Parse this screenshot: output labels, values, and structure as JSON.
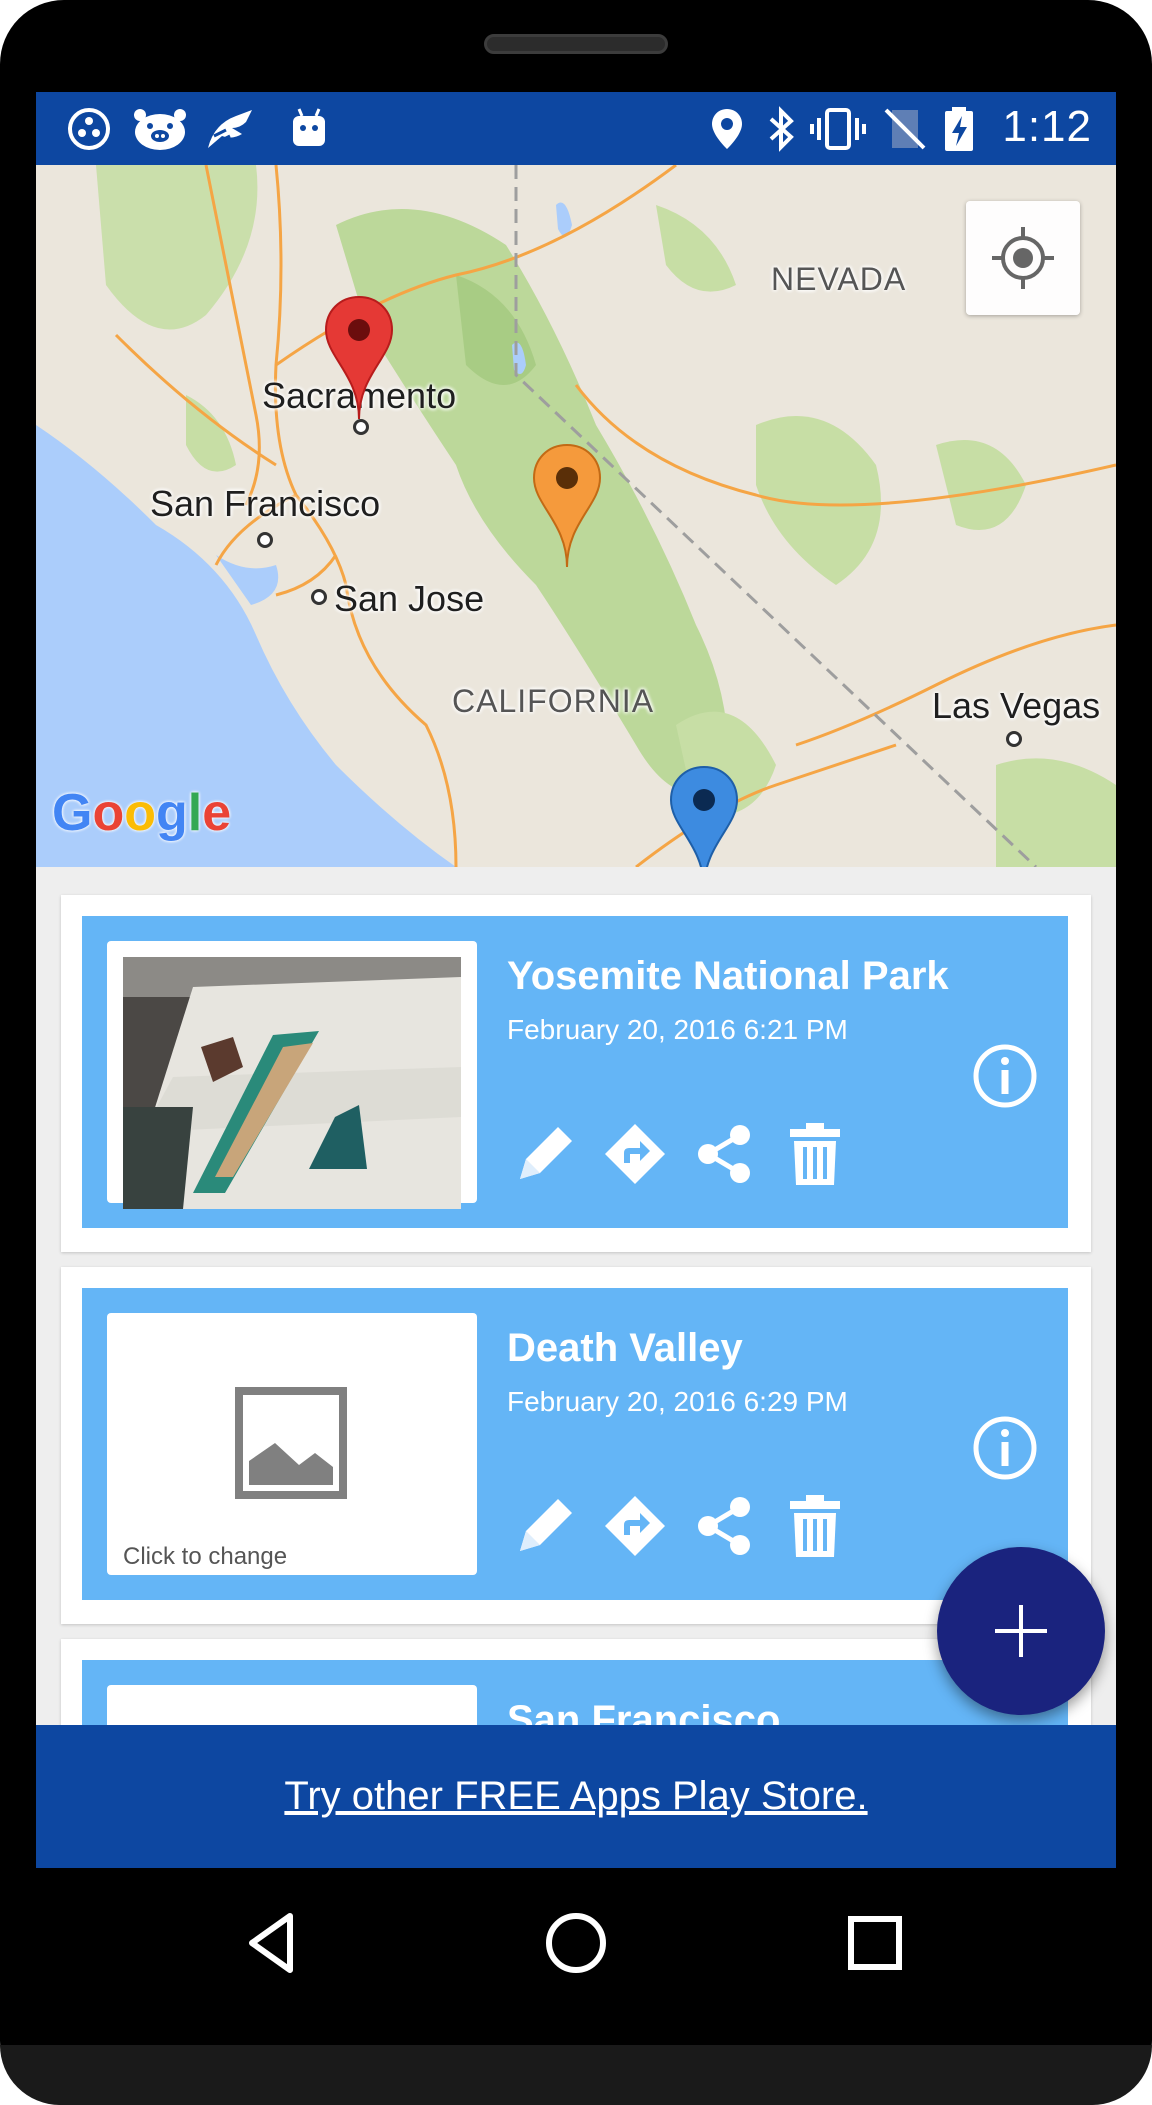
{
  "status_bar": {
    "time": "1:12",
    "left_icons": [
      "dots-circle-icon",
      "pig-icon",
      "bird-icon",
      "android-icon"
    ],
    "right_icons": [
      "location-icon",
      "bluetooth-icon",
      "vibrate-icon",
      "no-signal-icon",
      "battery-charging-icon"
    ],
    "background": "#0d47a1"
  },
  "map": {
    "labels": {
      "nevada": "NEVADA",
      "sacramento": "Sacramento",
      "san_francisco": "San Francisco",
      "san_jose": "San Jose",
      "california": "CALIFORNIA",
      "las_vegas": "Las Vegas"
    },
    "pins": [
      {
        "name": "red",
        "color": "#e53935"
      },
      {
        "name": "orange",
        "color": "#f59a3c"
      },
      {
        "name": "blue",
        "color": "#3d8be0"
      }
    ],
    "logo_text": "Google"
  },
  "cards": [
    {
      "title": "Yosemite National Park",
      "date": "February 20, 2016 6:21 PM",
      "thumb_caption": ""
    },
    {
      "title": "Death Valley",
      "date": "February 20, 2016 6:29 PM",
      "thumb_caption": "Click to change"
    },
    {
      "title": "San Francisco",
      "date": "",
      "thumb_caption": ""
    }
  ],
  "card_actions": [
    "edit-icon",
    "directions-icon",
    "share-icon",
    "delete-icon"
  ],
  "banner": {
    "text": "Try other FREE Apps Play Store."
  },
  "colors": {
    "card_accent": "#64b5f6",
    "fab": "#1a237e",
    "banner": "#0d47a1"
  }
}
